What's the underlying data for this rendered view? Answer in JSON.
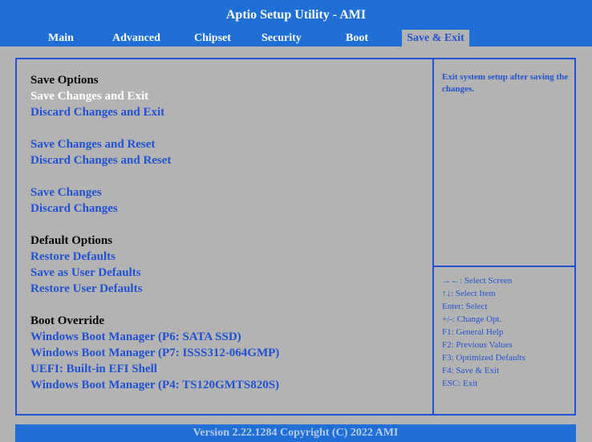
{
  "title": "Aptio Setup Utility - AMI",
  "tabs": [
    {
      "label": "Main"
    },
    {
      "label": "Advanced"
    },
    {
      "label": "Chipset"
    },
    {
      "label": "Security"
    },
    {
      "label": "Boot"
    },
    {
      "label": "Save & Exit"
    }
  ],
  "menu": {
    "save_options": {
      "header": "Save Options",
      "items": [
        "Save Changes and Exit",
        "Discard Changes and Exit"
      ]
    },
    "reset_options": {
      "items": [
        "Save Changes and Reset",
        "Discard Changes and Reset"
      ]
    },
    "changes_options": {
      "items": [
        "Save Changes",
        "Discard Changes"
      ]
    },
    "default_options": {
      "header": "Default Options",
      "items": [
        "Restore Defaults",
        "Save as User Defaults",
        "Restore User Defaults"
      ]
    },
    "boot_override": {
      "header": "Boot Override",
      "items": [
        "Windows Boot Manager (P6: SATA SSD)",
        "Windows Boot Manager (P7: ISSS312-064GMP)",
        "UEFI: Built-in EFI Shell",
        "Windows Boot Manager (P4: TS120GMTS820S)"
      ]
    }
  },
  "help_text": "Exit system setup after saving the changes.",
  "key_help": [
    "→←: Select Screen",
    "↑↓: Select Item",
    "Enter: Select",
    "+/-: Change Opt.",
    "F1: General Help",
    "F2: Previous Values",
    "F3: Optimized Defaults",
    "F4: Save & Exit",
    "ESC: Exit"
  ],
  "footer": "Version 2.22.1284 Copyright (C) 2022 AMI",
  "colors": {
    "bar_blue": "#1f6fd6",
    "text_blue": "#1f52d2",
    "background_gray": "#b3b3b3",
    "selected_text": "#ffffff"
  }
}
